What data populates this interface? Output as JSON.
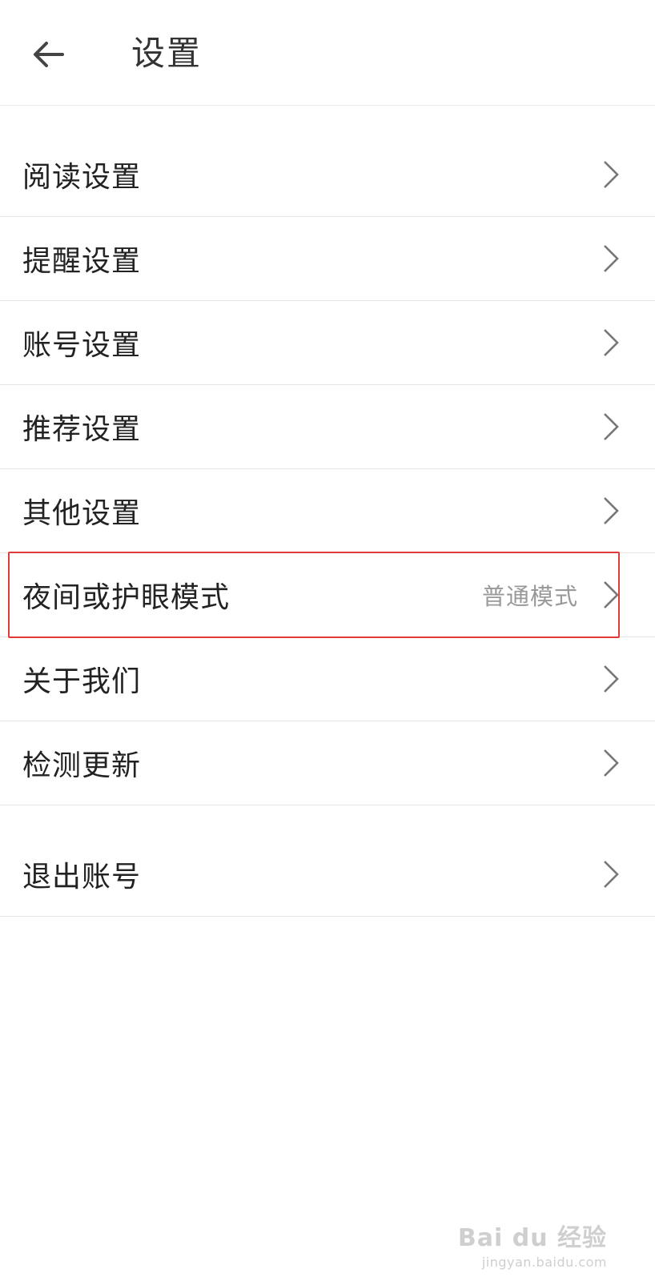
{
  "header": {
    "title": "设置"
  },
  "settings_items": [
    {
      "label": "阅读设置"
    },
    {
      "label": "提醒设置"
    },
    {
      "label": "账号设置"
    },
    {
      "label": "推荐设置"
    },
    {
      "label": "其他设置"
    },
    {
      "label": "夜间或护眼模式",
      "value": "普通模式"
    },
    {
      "label": "关于我们"
    },
    {
      "label": "检测更新"
    }
  ],
  "logout": {
    "label": "退出账号"
  },
  "watermark": {
    "logo": "Bai du 经验",
    "url": "jingyan.baidu.com"
  },
  "colors": {
    "highlight": "#e03a3a",
    "divider": "#e6e6e6",
    "value_text": "#999999"
  }
}
